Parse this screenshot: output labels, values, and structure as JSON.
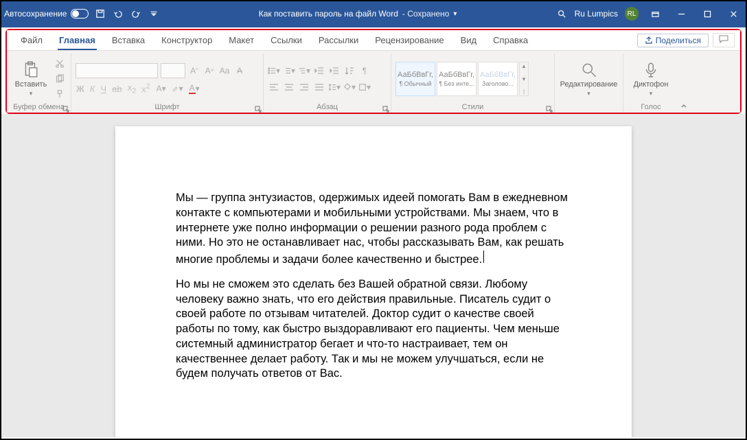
{
  "title_bar": {
    "autosave": "Автосохранение",
    "doc_title": "Как поставить пароль на файл Word",
    "save_state": "- Сохранено",
    "username": "Ru Lumpics",
    "avatar_initials": "RL"
  },
  "tabs": {
    "file": "Файл",
    "home": "Главная",
    "insert": "Вставка",
    "design": "Конструктор",
    "layout": "Макет",
    "references": "Ссылки",
    "mailings": "Рассылки",
    "review": "Рецензирование",
    "view": "Вид",
    "help": "Справка",
    "share": "Поделиться"
  },
  "groups": {
    "clipboard": {
      "paste": "Вставить",
      "label": "Буфер обмена"
    },
    "font": {
      "label": "Шрифт",
      "bold": "Ж",
      "italic": "К",
      "underline": "Ч",
      "strike": "ab",
      "sub": "x₂",
      "sup": "x²",
      "grow": "A^",
      "shrink": "A˅",
      "case": "Aa",
      "clear": "A̸"
    },
    "paragraph": {
      "label": "Абзац",
      "pilcrow": "¶"
    },
    "styles": {
      "label": "Стили",
      "preview": "АаБбВвГг,",
      "normal": "¶ Обычный",
      "nospace": "¶ Без инте...",
      "heading1": "Заголово..."
    },
    "editing": {
      "label": "Редактирование"
    },
    "voice": {
      "dictate": "Диктофон",
      "label": "Голос"
    }
  },
  "document": {
    "paragraph1": "Мы — группа энтузиастов, одержимых идеей помогать Вам в ежедневном контакте с компьютерами и мобильными устройствами. Мы знаем, что в интернете уже полно информации о решении разного рода проблем с ними. Но это не останавливает нас, чтобы рассказывать Вам, как решать многие проблемы и задачи более качественно и быстрее.",
    "paragraph2": "Но мы не сможем это сделать без Вашей обратной связи. Любому человеку важно знать, что его действия правильные. Писатель судит о своей работе по отзывам читателей. Доктор судит о качестве своей работы по тому, как быстро выздоравливают его пациенты. Чем меньше системный администратор бегает и что-то настраивает, тем он качественнее делает работу. Так и мы не можем улучшаться, если не будем получать ответов от Вас."
  }
}
